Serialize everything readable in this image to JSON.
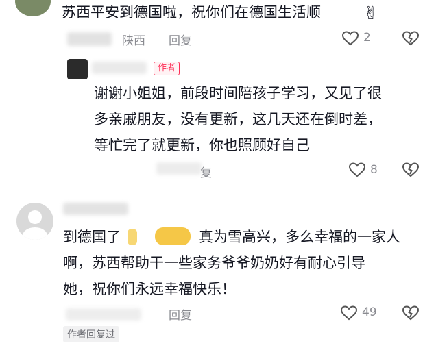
{
  "comments": [
    {
      "text": "苏西平安到德国啦，祝你们在德国生活顺",
      "location": "陕西",
      "reply_label": "回复",
      "like_count": "2",
      "dislike_icon": "broken-heart-icon",
      "like_icon": "heart-icon"
    },
    {
      "author_badge": "作者",
      "lines": [
        "谢谢小姐姐，前段时间陪孩子学习，又见了很",
        "多亲戚朋友，没有更新，这几天还在倒时差，",
        "等忙完了就更新，你也照顾好自己"
      ],
      "reply_label": "复",
      "like_count": "8"
    },
    {
      "lines": [
        "到德国了",
        "真为雪高兴，多么幸福的一家人",
        "啊，苏西帮助干一些家务爷爷奶奶好有耐心引导",
        "她，祝你们永远幸福快乐！"
      ],
      "reply_label": "回复",
      "like_count": "49",
      "author_replied": "作者回复过"
    }
  ],
  "colors": {
    "accent": "#fe2c55",
    "text": "#161823",
    "meta": "#8a8b91"
  }
}
